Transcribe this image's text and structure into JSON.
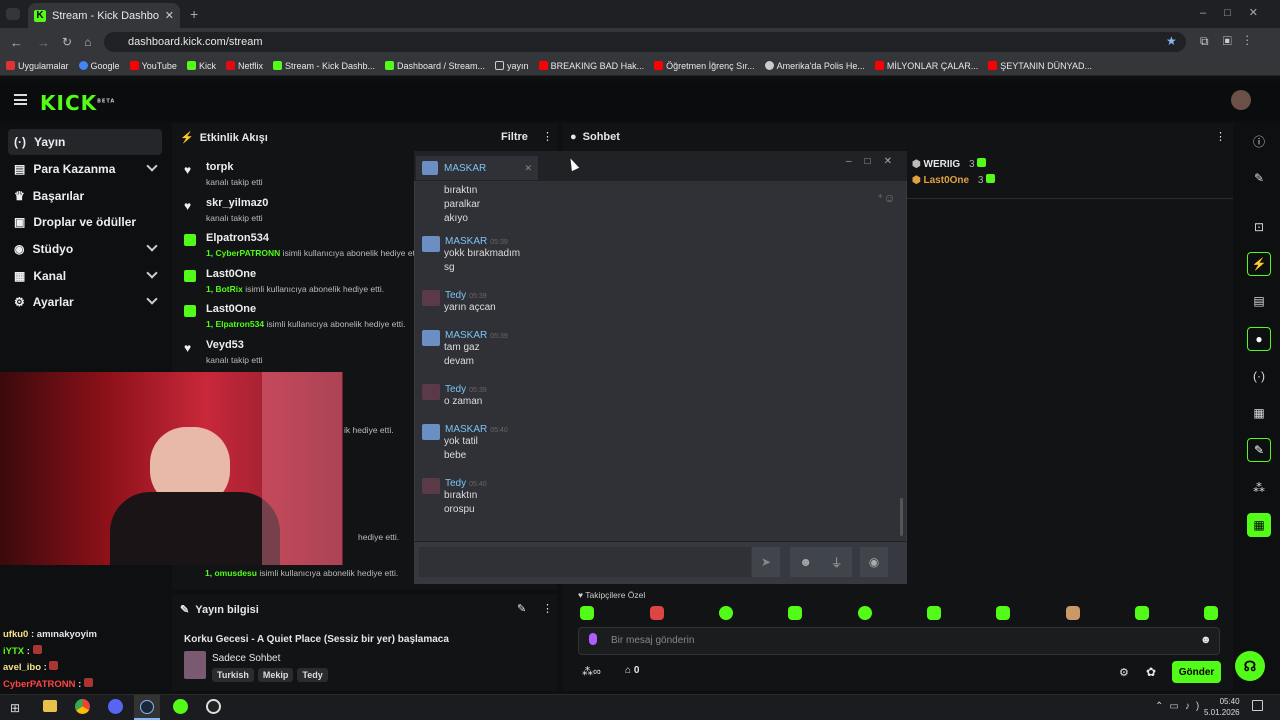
{
  "browser": {
    "tab_title": "Stream - Kick Dashboard",
    "url": "dashboard.kick.com/stream",
    "bookmarks": [
      "Uygulamalar",
      "Google",
      "YouTube",
      "Kick",
      "Netflix",
      "Stream - Kick Dashb...",
      "Dashboard / Stream...",
      "yayın",
      "BREAKING BAD Hak...",
      "Öğretmen İğrenç Sır...",
      "Amerika'da Polis He...",
      "MİLYONLAR ÇALAR...",
      "ŞEYTANIN DÜNYAD..."
    ]
  },
  "header": {
    "logo": "KICK",
    "beta": "BETA"
  },
  "sidebar": {
    "items": [
      {
        "label": "Yayın"
      },
      {
        "label": "Para Kazanma"
      },
      {
        "label": "Başarılar"
      },
      {
        "label": "Droplar ve ödüller"
      },
      {
        "label": "Stüdyo"
      },
      {
        "label": "Kanal"
      },
      {
        "label": "Ayarlar"
      }
    ]
  },
  "events": {
    "title": "Etkinlik Akışı",
    "filter": "Filtre",
    "items": [
      {
        "name": "torpk",
        "sub": "kanalı takip etti"
      },
      {
        "name": "skr_yilmaz0",
        "sub": "kanalı takip etti"
      },
      {
        "name": "Elpatron534",
        "pre": "1, CyberPATRONN",
        "sub": " isimli kullanıcıya abonelik hediye ett"
      },
      {
        "name": "Last0One",
        "pre": "1, BotRix",
        "sub": " isimli kullanıcıya abonelik hediye etti."
      },
      {
        "name": "Last0One",
        "pre": "1, Elpatron534",
        "sub": " isimli kullanıcıya abonelik hediye etti."
      },
      {
        "name": "Veyd53",
        "sub": "kanalı takip etti"
      }
    ],
    "partial": [
      "ik hediye etti.",
      "hediye etti.",
      "isimli kullanıcıya abonelik hediye etti."
    ],
    "last_pre": "1, omusdesu"
  },
  "chat_popup": {
    "tab": "MASKAR",
    "top_lines": [
      "bıraktın",
      "paralkar",
      "akıyo"
    ],
    "messages": [
      {
        "user": "MASKAR",
        "time": "05:39",
        "lines": [
          "yokk bırakmadım",
          "sg"
        ]
      },
      {
        "user": "Tedy",
        "time": "05:39",
        "lines": [
          "yarın açcan"
        ]
      },
      {
        "user": "MASKAR",
        "time": "05:39",
        "lines": [
          "tam gaz",
          "devam"
        ]
      },
      {
        "user": "Tedy",
        "time": "05:39",
        "lines": [
          "o zaman"
        ]
      },
      {
        "user": "MASKAR",
        "time": "05:40",
        "lines": [
          "yok tatil",
          "bebe"
        ]
      },
      {
        "user": "Tedy",
        "time": "05:40",
        "lines": [
          "bıraktın",
          "orospu"
        ]
      }
    ]
  },
  "sohbet": {
    "title": "Sohbet",
    "leaders": [
      {
        "name": "WERIIG",
        "count": "3"
      },
      {
        "name": "Last0One",
        "count": "3"
      }
    ],
    "followers_only": "Takipçilere Özel",
    "placeholder": "Bir mesaj gönderin",
    "send": "Gönder",
    "viewer_count": "0"
  },
  "stream_info": {
    "title": "Yayın bilgisi",
    "stream_title": "Korku Gecesi - A Quiet Place (Sessiz bir yer) başlamaca",
    "category": "Sadece Sohbet",
    "tags": [
      "Turkish",
      "Mekip",
      "Tedy"
    ]
  },
  "overlay_chat": [
    {
      "user": "ufku0",
      "text": " : amınakyoyim"
    },
    {
      "user": "iYTX",
      "text": " : "
    },
    {
      "user": "avel_ibo",
      "text": " : "
    },
    {
      "user": "CyberPATRONN",
      "text": " : "
    }
  ],
  "clock": {
    "time": "05:40",
    "date": "5.01.2026"
  },
  "colors": {
    "accent": "#53fc18",
    "popup_user": "#7cc4f5"
  }
}
